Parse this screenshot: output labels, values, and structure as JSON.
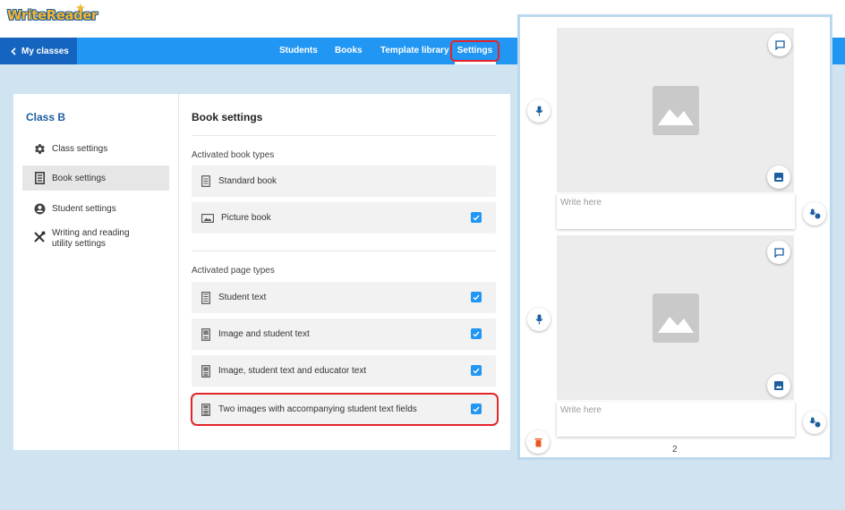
{
  "app": {
    "logo": "WriteReader"
  },
  "nav": {
    "back_label": "My classes",
    "links": [
      "Students",
      "Books",
      "Template library",
      "Settings"
    ]
  },
  "sidebar": {
    "class_name": "Class B",
    "items": [
      {
        "label": "Class settings",
        "icon": "gear-icon"
      },
      {
        "label": "Book settings",
        "icon": "book-icon",
        "active": true
      },
      {
        "label": "Student settings",
        "icon": "account-icon"
      },
      {
        "label": "Writing and reading utility settings",
        "icon": "tools-icon"
      }
    ]
  },
  "book_settings": {
    "title": "Book settings",
    "book_types_label": "Activated book types",
    "book_types": [
      {
        "label": "Standard book",
        "checked": false
      },
      {
        "label": "Picture book",
        "checked": true
      }
    ],
    "page_types_label": "Activated page types",
    "page_types": [
      {
        "label": "Student text",
        "checked": true
      },
      {
        "label": "Image and student text",
        "checked": true
      },
      {
        "label": "Image, student text and educator text",
        "checked": true
      },
      {
        "label": "Two images with accompanying student text fields",
        "checked": true
      }
    ]
  },
  "preview": {
    "text_placeholder_1": "Write here",
    "text_placeholder_2": "Write here",
    "page_number": "2"
  },
  "colors": {
    "nav_blue": "#2196f3",
    "back_blue": "#1565c0",
    "class_title": "#1d5fa0",
    "checkbox": "#2196f3",
    "highlight": "#e1252a",
    "delete": "#e8591a"
  }
}
